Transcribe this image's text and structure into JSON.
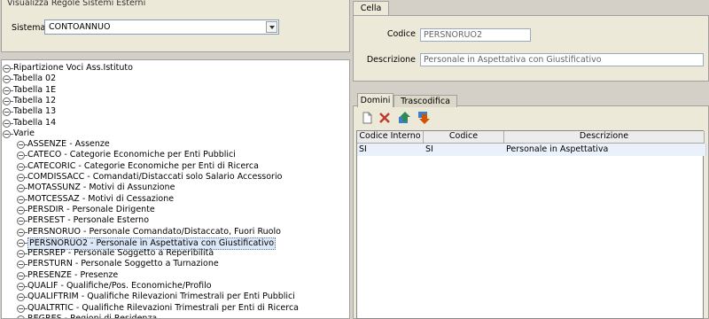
{
  "left_panel": {
    "group_title": "Visualizza Regole Sistemi Esterni",
    "sistema_label": "Sistema",
    "sistema_value": "CONTOANNUO"
  },
  "tree": {
    "root_items": [
      "Ripartizione Voci Ass.Istituto",
      "Tabella 02",
      "Tabella 1E",
      "Tabella 12",
      "Tabella 13",
      "Tabella 14",
      "Varie"
    ],
    "child_items": [
      "ASSENZE - Assenze",
      "CATECO - Categorie Economiche per Enti Pubblici",
      "CATECORIC - Categorie Economiche per Enti di Ricerca",
      "COMDISSACC - Comandati/Distaccati solo Salario Accessorio",
      "MOTASSUNZ - Motivi di Assunzione",
      "MOTCESSAZ - Motivi di Cessazione",
      "PERSDIR - Personale Dirigente",
      "PERSEST - Personale Esterno",
      "PERSNORUO - Personale Comandato/Distaccato, Fuori Ruolo",
      "PERSNORUO2 - Personale in Aspettativa con Giustificativo",
      "PERSREP - Personale Soggetto a Reperibilità",
      "PERSTURN - Personale Soggetto a Turnazione",
      "PRESENZE - Presenze",
      "QUALIF - Qualifiche/Pos. Economiche/Profilo",
      "QUALIFTRIM - Qualifiche Rilevazioni Trimestrali per Enti Pubblici",
      "QUALTRTIC - Qualifiche Rilevazioni Trimestrali per Enti di Ricerca",
      "REGRES - Regioni di Residenza"
    ],
    "selected_index": 9
  },
  "cella": {
    "tab_label": "Cella",
    "codice_label": "Codice",
    "codice_value": "PERSNORUO2",
    "descrizione_label": "Descrizione",
    "descrizione_value": "Personale in Aspettativa con Giustificativo"
  },
  "tabs": {
    "domini": "Domini",
    "trascodifica": "Trascodifica"
  },
  "toolbar": {
    "icons": [
      "new-icon",
      "delete-icon",
      "move-up-icon",
      "move-down-icon"
    ],
    "colors": {
      "delete": "#c0392b",
      "up": "#2e8b57",
      "down": "#d35400"
    }
  },
  "grid": {
    "columns": [
      "Codice Interno",
      "Codice",
      "Descrizione"
    ],
    "rows": [
      [
        "SI",
        "SI",
        "Personale in Aspettativa"
      ]
    ]
  }
}
